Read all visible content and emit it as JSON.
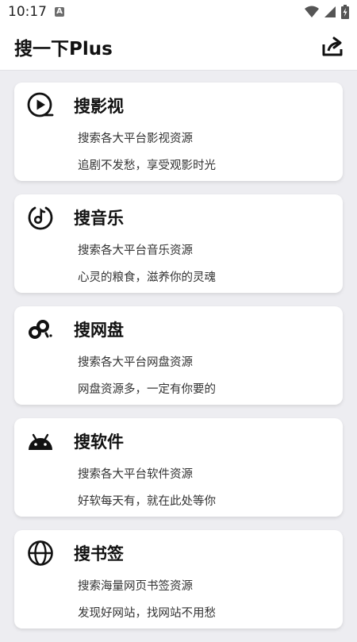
{
  "status": {
    "time": "10:17",
    "notification_letter": "A"
  },
  "app": {
    "title": "搜一下Plus"
  },
  "cards": [
    {
      "title": "搜影视",
      "line1": "搜索各大平台影视资源",
      "line2": "追剧不发愁，享受观影时光",
      "icon": "play-circle-icon"
    },
    {
      "title": "搜音乐",
      "line1": "搜索各大平台音乐资源",
      "line2": "心灵的粮食，滋养你的灵魂",
      "icon": "music-note-icon"
    },
    {
      "title": "搜网盘",
      "line1": "搜索各大平台网盘资源",
      "line2": "网盘资源多，一定有你要的",
      "icon": "cloud-drive-icon"
    },
    {
      "title": "搜软件",
      "line1": "搜索各大平台软件资源",
      "line2": "好软每天有，就在此处等你",
      "icon": "android-icon"
    },
    {
      "title": "搜书签",
      "line1": "搜索海量网页书签资源",
      "line2": "发现好网站，找网站不用愁",
      "icon": "globe-icon"
    }
  ]
}
